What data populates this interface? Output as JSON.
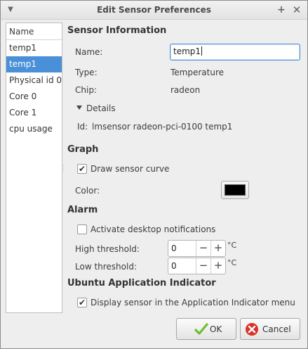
{
  "window": {
    "title": "Edit Sensor Preferences"
  },
  "sidebar": {
    "header": "Name",
    "items": [
      {
        "label": "temp1"
      },
      {
        "label": "temp1"
      },
      {
        "label": "Physical id 0"
      },
      {
        "label": "Core 0"
      },
      {
        "label": "Core 1"
      },
      {
        "label": "cpu usage"
      }
    ],
    "selected_index": 1
  },
  "sensor_info": {
    "heading": "Sensor Information",
    "name_label": "Name:",
    "name_value": "temp1",
    "type_label": "Type:",
    "type_value": "Temperature",
    "chip_label": "Chip:",
    "chip_value": "radeon",
    "details_label": "Details",
    "id_label": "Id:",
    "id_value": "lmsensor radeon-pci-0100 temp1"
  },
  "graph": {
    "heading": "Graph",
    "draw_curve_label": "Draw sensor curve",
    "draw_curve_checked": true,
    "color_label": "Color:",
    "color_value": "#000000"
  },
  "alarm": {
    "heading": "Alarm",
    "notify_label": "Activate desktop notifications",
    "notify_checked": false,
    "high_label": "High threshold:",
    "high_value": "0",
    "low_label": "Low threshold:",
    "low_value": "0",
    "unit": "°C"
  },
  "indicator": {
    "heading": "Ubuntu Application Indicator",
    "display_label": "Display sensor in the Application Indicator menu",
    "display_checked": true
  },
  "buttons": {
    "ok": "OK",
    "cancel": "Cancel"
  },
  "icons": {
    "window_menu": "chevron-down-icon",
    "pin": "pin-icon",
    "close": "close-icon",
    "ok": "checkmark-icon",
    "cancel": "cancel-icon",
    "details": "expander-triangle-icon"
  },
  "colors": {
    "selection": "#4a90d9",
    "ok_icon": "#6cbf2e",
    "cancel_icon": "#d9342b"
  }
}
